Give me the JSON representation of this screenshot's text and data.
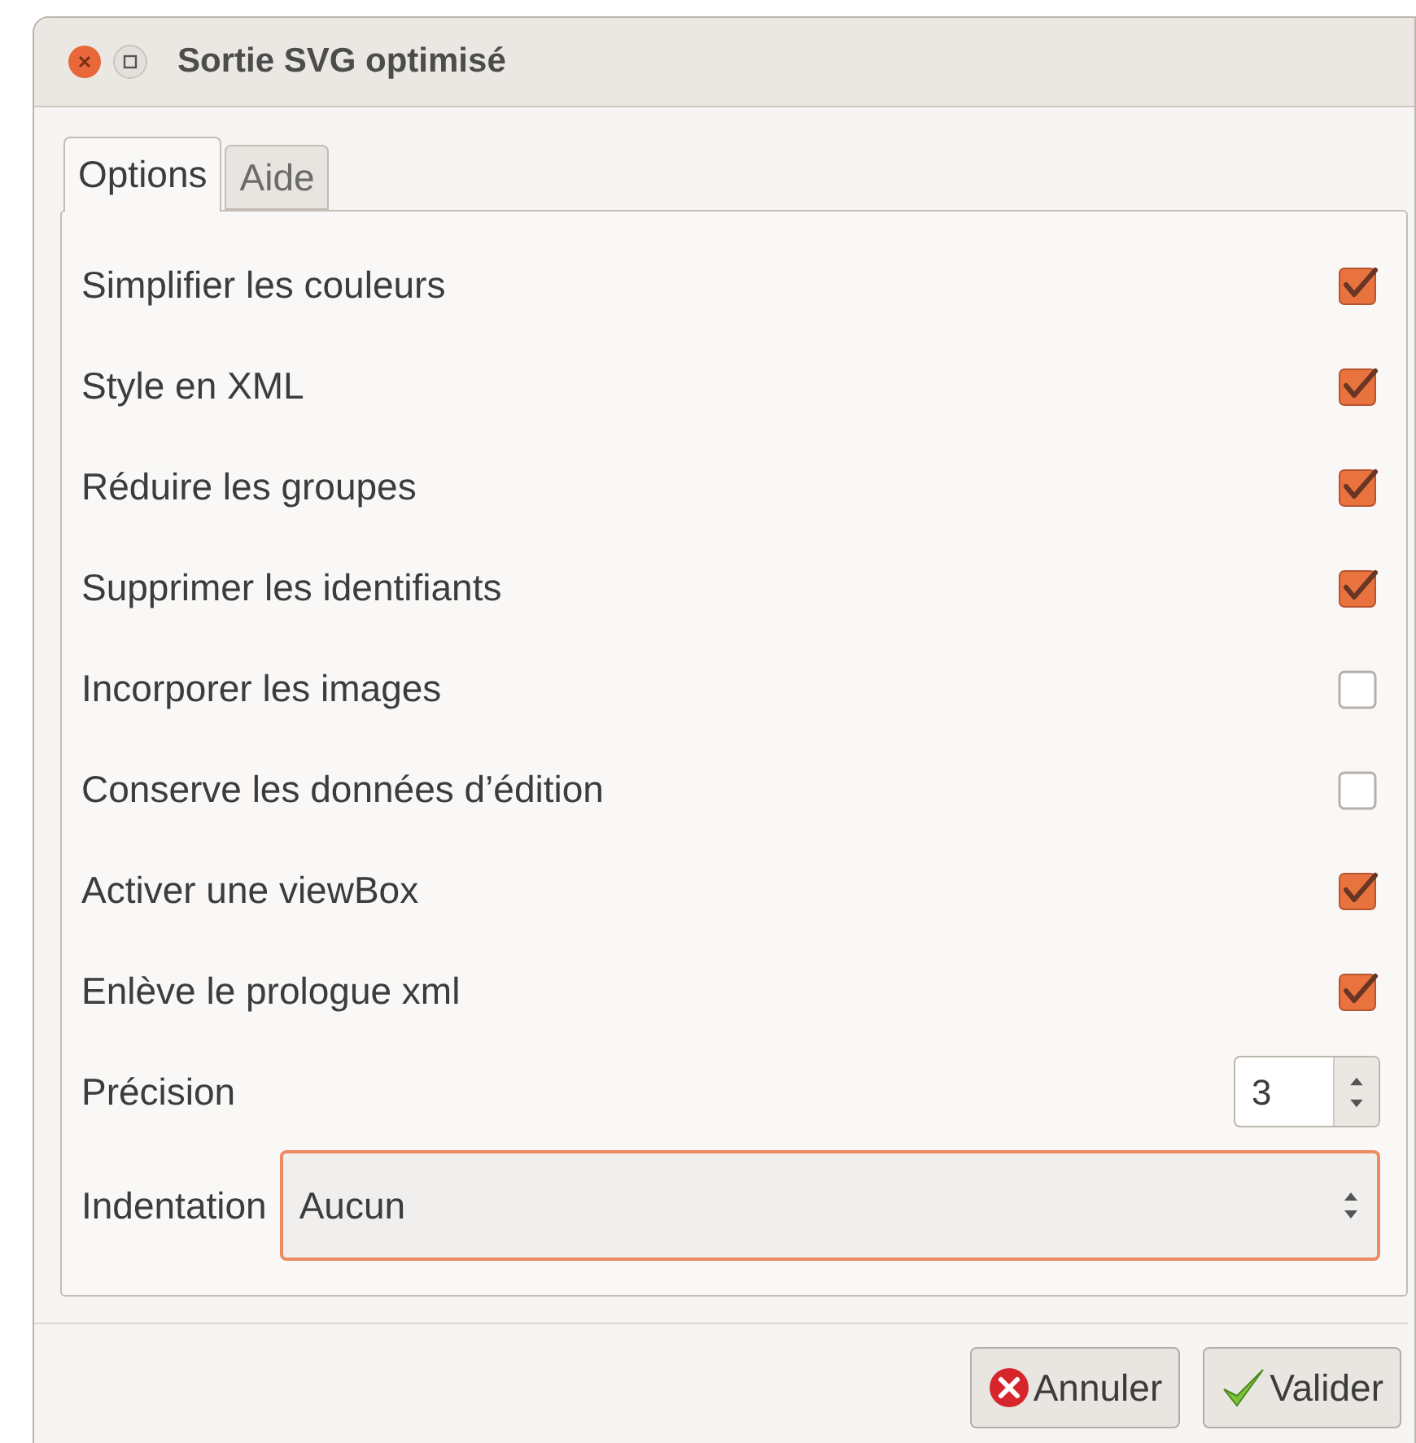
{
  "window": {
    "title": "Sortie SVG optimisé"
  },
  "tabs": [
    {
      "label": "Options",
      "selected": true
    },
    {
      "label": "Aide",
      "selected": false
    }
  ],
  "options": [
    {
      "label": "Simplifier les couleurs",
      "checked": true
    },
    {
      "label": "Style en XML",
      "checked": true
    },
    {
      "label": "Réduire les groupes",
      "checked": true
    },
    {
      "label": "Supprimer les identifiants",
      "checked": true
    },
    {
      "label": "Incorporer les images",
      "checked": false
    },
    {
      "label": "Conserve les données d’édition",
      "checked": false
    },
    {
      "label": "Activer une viewBox",
      "checked": true
    },
    {
      "label": "Enlève le prologue xml",
      "checked": true
    }
  ],
  "precision": {
    "label": "Précision",
    "value": "3"
  },
  "indentation": {
    "label": "Indentation",
    "value": "Aucun"
  },
  "buttons": [
    {
      "label": "Annuler",
      "kind": "cancel"
    },
    {
      "label": "Valider",
      "kind": "ok"
    }
  ]
}
